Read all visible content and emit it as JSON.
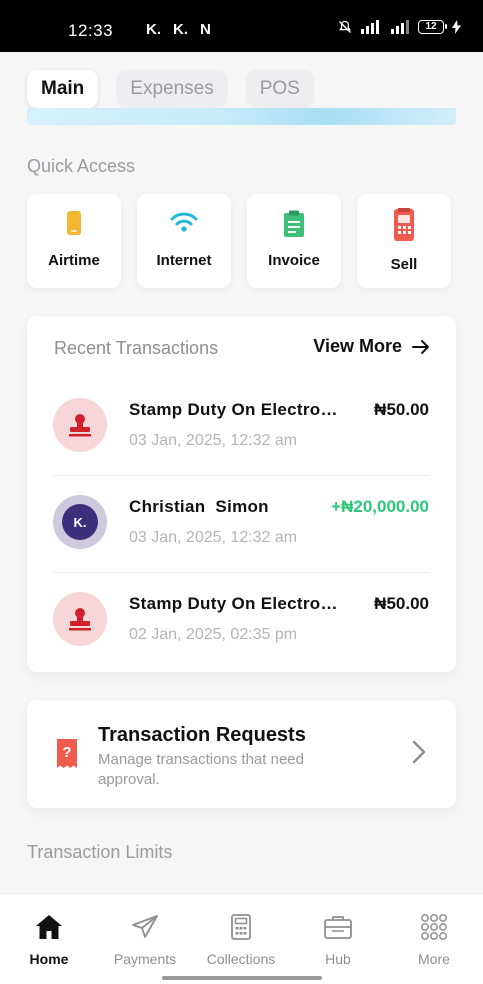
{
  "status_bar": {
    "time": "12:33",
    "apps": [
      "K.",
      "K.",
      "N"
    ],
    "battery": "12"
  },
  "tabs": [
    {
      "label": "Main",
      "active": true
    },
    {
      "label": "Expenses",
      "active": false
    },
    {
      "label": "POS",
      "active": false
    }
  ],
  "quick_access": {
    "title": "Quick Access",
    "items": [
      {
        "label": "Airtime",
        "icon": "phone-icon",
        "color": "#f5b731"
      },
      {
        "label": "Internet",
        "icon": "wifi-icon",
        "color": "#26b6d9"
      },
      {
        "label": "Invoice",
        "icon": "clipboard-icon",
        "color": "#3cc07a"
      },
      {
        "label": "Sell",
        "icon": "pos-terminal-icon",
        "color": "#ef5b4e"
      }
    ]
  },
  "recent_transactions": {
    "title": "Recent Transactions",
    "view_more": "View More",
    "items": [
      {
        "name": "Stamp Duty On Electronic Transfer",
        "date": "03 Jan, 2025, 12:32 am",
        "amount": "₦50.00",
        "type": "debit",
        "avatar": "stamp-icon"
      },
      {
        "name": "Christian  Simon",
        "date": "03 Jan, 2025, 12:32 am",
        "amount": "+₦20,000.00",
        "type": "credit",
        "avatar": "K."
      },
      {
        "name": "Stamp Duty On Electronic Transfer",
        "date": "02 Jan, 2025, 02:35 pm",
        "amount": "₦50.00",
        "type": "debit",
        "avatar": "stamp-icon"
      }
    ]
  },
  "transaction_requests": {
    "title": "Transaction Requests",
    "subtitle": "Manage transactions that need approval."
  },
  "transaction_limits": {
    "title": "Transaction Limits"
  },
  "bottom_nav": [
    {
      "label": "Home",
      "icon": "home-icon",
      "active": true
    },
    {
      "label": "Payments",
      "icon": "send-icon",
      "active": false
    },
    {
      "label": "Collections",
      "icon": "calculator-icon",
      "active": false
    },
    {
      "label": "Hub",
      "icon": "briefcase-icon",
      "active": false
    },
    {
      "label": "More",
      "icon": "grid-dots-icon",
      "active": false
    }
  ],
  "colors": {
    "accent_credit": "#2ec77a",
    "avatar_debit_bg": "#f6d6d8",
    "avatar_debit_icon": "#d0202a",
    "avatar_credit_bg": "#cfc9de",
    "brand": "#3b2e7a"
  }
}
